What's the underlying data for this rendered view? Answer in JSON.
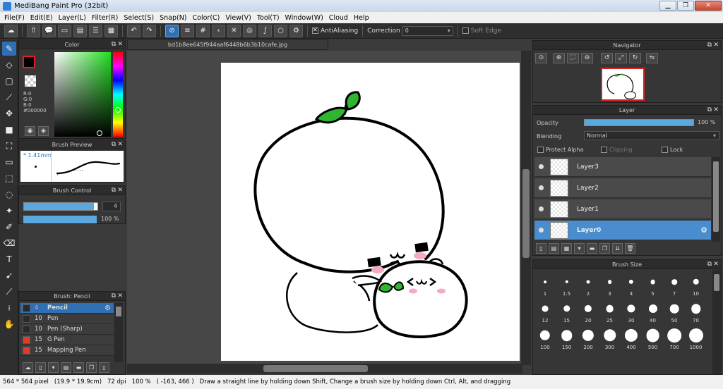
{
  "window": {
    "title": "MediBang Paint Pro (32bit)"
  },
  "menu": [
    "File(F)",
    "Edit(E)",
    "Layer(L)",
    "Filter(R)",
    "Select(S)",
    "Snap(N)",
    "Color(C)",
    "View(V)",
    "Tool(T)",
    "Window(W)",
    "Cloud",
    "Help"
  ],
  "toolbar": {
    "antialiasing_label": "AntiAliasing",
    "antialiasing_checked": true,
    "correction_label": "Correction",
    "correction_value": "0",
    "soft_edge_label": "Soft Edge",
    "soft_edge_checked": false,
    "buttons": [
      "cloud-icon",
      "upload-icon",
      "comment-icon",
      "message-icon",
      "document-icon",
      "list-icon",
      "grid-list-icon",
      "undo-icon",
      "redo-icon",
      "snap-off-icon",
      "parallel-snap-icon",
      "grid-snap-icon",
      "perspective-snap-icon",
      "radial-snap-icon",
      "concentric-snap-icon",
      "curve-snap-icon",
      "circle-snap-icon",
      "settings-icon"
    ]
  },
  "color_panel": {
    "title": "Color",
    "readout": {
      "r": "R:0",
      "g": "G:0",
      "b": "B:0",
      "hex": "#000000"
    },
    "foreground": "#000000"
  },
  "brush_preview": {
    "title": "Brush Preview",
    "size_text": "* 1.41mm"
  },
  "brush_control": {
    "title": "Brush Control",
    "size_value": "4",
    "size_fraction": 0.95,
    "opacity_text": "100 %",
    "opacity_fraction": 1.0
  },
  "brush_list": {
    "title": "Brush: Pencil",
    "items": [
      {
        "size": "4",
        "name": "Pencil",
        "swatch": "#2a2a2a",
        "selected": true
      },
      {
        "size": "10",
        "name": "Pen",
        "swatch": "#2a2a2a",
        "selected": false
      },
      {
        "size": "10",
        "name": "Pen (Sharp)",
        "swatch": "#2a2a2a",
        "selected": false
      },
      {
        "size": "15",
        "name": "G Pen",
        "swatch": "#e23a2a",
        "selected": false
      },
      {
        "size": "15",
        "name": "Mapping Pen",
        "swatch": "#e23a2a",
        "selected": false
      }
    ]
  },
  "document": {
    "tab": "bd1b8ee645f944aaf6448b6b3b10cafe.jpg"
  },
  "navigator": {
    "title": "Navigator"
  },
  "layer_panel": {
    "title": "Layer",
    "opacity_label": "Opacity",
    "opacity_value": "100 %",
    "blending_label": "Blending",
    "blending_value": "Normal",
    "protect_alpha": "Protect Alpha",
    "clipping": "Clipping",
    "lock": "Lock",
    "layers": [
      {
        "name": "Layer3",
        "selected": false
      },
      {
        "name": "Layer2",
        "selected": false
      },
      {
        "name": "Layer1",
        "selected": false
      },
      {
        "name": "Layer0",
        "selected": true
      }
    ]
  },
  "brush_size": {
    "title": "Brush Size",
    "sizes": [
      "1",
      "1.5",
      "2",
      "3",
      "4",
      "5",
      "7",
      "10",
      "12",
      "15",
      "20",
      "25",
      "30",
      "40",
      "50",
      "70",
      "100",
      "150",
      "200",
      "300",
      "400",
      "500",
      "700",
      "1000"
    ]
  },
  "status": {
    "dimensions": "564 * 564 pixel",
    "physical": "(19.9 * 19.9cm)",
    "dpi": "72 dpi",
    "zoom": "100 %",
    "coords": "( -163, 466 )",
    "hint": "Draw a straight line by holding down Shift, Change a brush size by holding down Ctrl, Alt, and dragging"
  },
  "colors": {
    "accent": "#2f6fb3",
    "selection": "#4a8dcf",
    "leaf": "#2fb52f",
    "panel": "#363636"
  }
}
